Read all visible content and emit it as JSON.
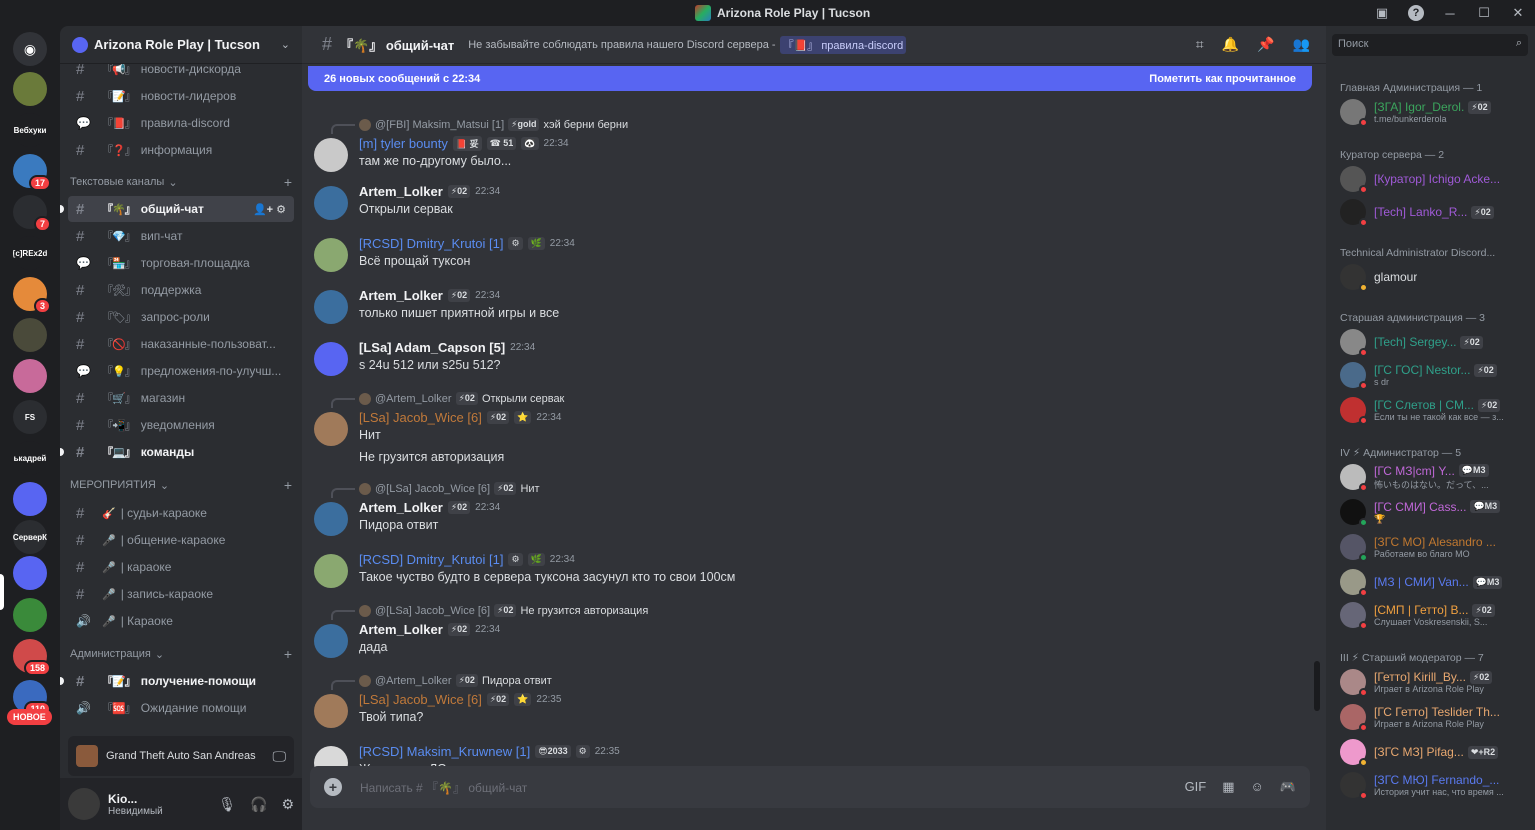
{
  "window": {
    "title": "Arizona Role Play | Tucson",
    "help_icon": "?"
  },
  "rail": {
    "discord_label": "Discord",
    "servers": [
      {
        "label": "",
        "color": "#6a7a3a",
        "badge": ""
      },
      {
        "label": "Вебхуки",
        "color": "#1e1f22",
        "badge": ""
      },
      {
        "label": "",
        "color": "#3a7abf",
        "badge": "17"
      },
      {
        "label": "",
        "color": "#2b2d31",
        "badge": "7"
      },
      {
        "label": "[c]REx2d",
        "color": "#1e1f22",
        "badge": ""
      },
      {
        "label": "",
        "color": "#e58a3a",
        "badge": "3"
      },
      {
        "label": "",
        "color": "#4a4a3a",
        "badge": ""
      },
      {
        "label": "",
        "color": "#c86a9a",
        "badge": ""
      },
      {
        "label": "FS",
        "color": "#2b2d31",
        "badge": ""
      },
      {
        "label": "ькадрей",
        "color": "#1e1f22",
        "badge": ""
      },
      {
        "label": "",
        "color": "#5865f2",
        "badge": ""
      },
      {
        "label": "СерверК",
        "color": "#2b2d31",
        "badge": ""
      },
      {
        "label": "",
        "color": "#5865f2",
        "badge": ""
      },
      {
        "label": "",
        "color": "#3a8a3a",
        "badge": ""
      },
      {
        "label": "",
        "color": "#d04a4a",
        "badge": "158"
      },
      {
        "label": "",
        "color": "#3a6abf",
        "badge": "110"
      }
    ],
    "new_label": "НОВОЕ"
  },
  "server": {
    "name": "Arizona Role Play | Tucson"
  },
  "channels": {
    "top": [
      {
        "emoji": "『📢』",
        "name": "новости-дискорда"
      },
      {
        "emoji": "『📝』",
        "name": "новости-лидеров"
      },
      {
        "emoji": "『📕』",
        "name": "правила-discord"
      },
      {
        "emoji": "『❓』",
        "name": "информация"
      }
    ],
    "cat_text": "Текстовые каналы",
    "text": [
      {
        "emoji": "『🌴』",
        "name": "общий-чат"
      },
      {
        "emoji": "『💎』",
        "name": "вип-чат"
      },
      {
        "emoji": "『🏪』",
        "name": "торговая-площадка"
      },
      {
        "emoji": "『🛠』",
        "name": "поддержка"
      },
      {
        "emoji": "『🏷』",
        "name": "запрос-роли"
      },
      {
        "emoji": "『🚫』",
        "name": "наказанные-пользоват..."
      },
      {
        "emoji": "『💡』",
        "name": "предложения-по-улучш..."
      },
      {
        "emoji": "『🛒』",
        "name": "магазин"
      },
      {
        "emoji": "『📲』",
        "name": "уведомления"
      },
      {
        "emoji": "『💻』",
        "name": "команды"
      }
    ],
    "cat_events": "МЕРОПРИЯТИЯ",
    "events": [
      {
        "emoji": "🎸",
        "name": "| судьи-караоке"
      },
      {
        "emoji": "🎤",
        "name": "| общение-караоке"
      },
      {
        "emoji": "🎤",
        "name": "| караоке"
      },
      {
        "emoji": "🎤",
        "name": "| запись-караоке"
      },
      {
        "emoji": "🎤",
        "name": "| Караоке"
      }
    ],
    "cat_admin": "Администрация",
    "admin": [
      {
        "emoji": "『📝』",
        "name": "получение-помощи"
      },
      {
        "emoji": "『🆘』",
        "name": "Ожидание помощи"
      }
    ]
  },
  "activity": {
    "game": "Grand Theft Auto San Andreas"
  },
  "user": {
    "name": "Kio...",
    "status": "Невидимый"
  },
  "chat": {
    "channel_name": "『🌴』 общий-чат",
    "topic": "Не забывайте соблюдать правила нашего Discord сервера -",
    "topic_link": "『📕』 правила-discord",
    "new_messages": "26 новых сообщений с 22:34",
    "mark_read": "Пометить как прочитанное",
    "composer_placeholder": "Написать # 『🌴』 общий-чат",
    "messages": [
      {
        "reply_user": "@[FBI] Maksim_Matsui [1]",
        "reply_tag": "⚡gold",
        "reply_text": "хэй берни берни",
        "user": "[m] tyler bounty",
        "user_class": "uname-blue",
        "tags": [
          "📕 妥",
          "☎ 51",
          "🐼"
        ],
        "time": "22:34",
        "lines": [
          "там же по-другому было..."
        ],
        "avatar": "#c9c9c9"
      },
      {
        "user": "Artem_Lolker",
        "user_class": "uname-m",
        "tags": [
          "⚡02"
        ],
        "time": "22:34",
        "lines": [
          "Открыли сервак"
        ],
        "avatar": "#3b6e9e"
      },
      {
        "user": "[RCSD] Dmitry_Krutoi [1]",
        "user_class": "uname-blue",
        "tags": [
          "⚙",
          "🌿"
        ],
        "time": "22:34",
        "lines": [
          "Всё прощай туксон"
        ],
        "avatar": "#8aa870"
      },
      {
        "user": "Artem_Lolker",
        "user_class": "uname-m",
        "tags": [
          "⚡02"
        ],
        "time": "22:34",
        "lines": [
          "только пишет приятной игры и все"
        ],
        "avatar": "#3b6e9e"
      },
      {
        "user": "[LSa] Adam_Capson [5]",
        "user_class": "uname-m",
        "tags": [],
        "time": "22:34",
        "lines": [
          "s 24u 512 или s25u 512?"
        ],
        "avatar": "#5865f2"
      },
      {
        "reply_user": "@Artem_Lolker",
        "reply_tag": "⚡02",
        "reply_text": "Открыли сервак",
        "user": "[LSa] Jacob_Wice [6]",
        "user_class": "uname-orange",
        "tags": [
          "⚡02",
          "⭐"
        ],
        "time": "22:34",
        "lines": [
          "Нит",
          "Не грузится авторизация"
        ],
        "avatar": "#a07a5a"
      },
      {
        "reply_user": "@[LSa] Jacob_Wice [6]",
        "reply_tag": "⚡02",
        "reply_text": "Нит",
        "user": "Artem_Lolker",
        "user_class": "uname-m",
        "tags": [
          "⚡02"
        ],
        "time": "22:34",
        "lines": [
          "Пидора отвит"
        ],
        "avatar": "#3b6e9e"
      },
      {
        "user": "[RCSD] Dmitry_Krutoi [1]",
        "user_class": "uname-blue",
        "tags": [
          "⚙",
          "🌿"
        ],
        "time": "22:34",
        "lines": [
          "Такое чуство будто в сервера туксона засунул кто то свои 100см"
        ],
        "avatar": "#8aa870"
      },
      {
        "reply_user": "@[LSa] Jacob_Wice [6]",
        "reply_tag": "⚡02",
        "reply_text": "Не грузится авторизация",
        "user": "Artem_Lolker",
        "user_class": "uname-m",
        "tags": [
          "⚡02"
        ],
        "time": "22:34",
        "lines": [
          "дада"
        ],
        "avatar": "#3b6e9e"
      },
      {
        "reply_user": "@Artem_Lolker",
        "reply_tag": "⚡02",
        "reply_text": "Пидора отвит",
        "user": "[LSa] Jacob_Wice [6]",
        "user_class": "uname-orange",
        "tags": [
          "⚡02",
          "⭐"
        ],
        "time": "22:35",
        "lines": [
          "Твой типа?"
        ],
        "avatar": "#a07a5a"
      },
      {
        "user": "[RCSD] Maksim_Kruwnew [1]",
        "user_class": "uname-blue",
        "tags": [
          "😎2033",
          "⚙"
        ],
        "time": "22:35",
        "lines": [
          "Женщина в ЛСа плохая примета"
        ],
        "avatar": "#d9d9d9"
      }
    ]
  },
  "members": {
    "search_placeholder": "Поиск",
    "groups": [
      {
        "title": "Главная Администрация — 1",
        "items": [
          {
            "name": "[ЗГА] Igor_Derol.",
            "color": "#3ba55d",
            "tag": "⚡02",
            "sub": "t.me/bunkerderola",
            "status": "#f23f42",
            "av": "#777"
          }
        ]
      },
      {
        "title": "Куратор сервера — 2",
        "items": [
          {
            "name": "[Куратор] Ichigo Acke...",
            "color": "#a05ad8",
            "tag": "",
            "sub": "",
            "status": "#f23f42",
            "av": "#555"
          },
          {
            "name": "[Tech] Lanko_R...",
            "color": "#a05ad8",
            "tag": "⚡02",
            "sub": "",
            "status": "#f23f42",
            "av": "#222"
          }
        ]
      },
      {
        "title": "Technical Administrator Discord...",
        "items": [
          {
            "name": "glamour",
            "color": "#dbdee1",
            "tag": "",
            "sub": "",
            "status": "#f0b232",
            "av": "#333"
          }
        ]
      },
      {
        "title": "Старшая администрация — 3",
        "items": [
          {
            "name": "[Tech] Sergey...",
            "color": "#2fa08a",
            "tag": "⚡02",
            "sub": "",
            "status": "#f23f42",
            "av": "#888"
          },
          {
            "name": "[ГС ГОС] Nestor...",
            "color": "#2fa08a",
            "tag": "⚡02",
            "sub": "s dr",
            "status": "#f23f42",
            "av": "#4a6a8a"
          },
          {
            "name": "[ГС Слетов | СМ...",
            "color": "#2fa08a",
            "tag": "⚡02",
            "sub": "Если ты не такой как все — з...",
            "status": "#f23f42",
            "av": "#c03030"
          }
        ]
      },
      {
        "title": "IV ⚡ Администратор — 5",
        "items": [
          {
            "name": "[ГС МЗ|cm] Y...",
            "color": "#c068d8",
            "tag": "💬M3",
            "sub": "怖いものはない。だって、...",
            "status": "#f23f42",
            "av": "#bbb"
          },
          {
            "name": "[ГС СМИ] Cass...",
            "color": "#c068d8",
            "tag": "💬M3",
            "sub": "🏆",
            "status": "#23a55a",
            "av": "#111"
          },
          {
            "name": "[ЗГС МО] Alesandro ...",
            "color": "#c07830",
            "tag": "",
            "sub": "Работаем во благо МО",
            "status": "#23a55a",
            "av": "#556"
          },
          {
            "name": "[МЗ | СМИ] Van...",
            "color": "#5a7af0",
            "tag": "💬M3",
            "sub": "",
            "status": "#f23f42",
            "av": "#998"
          },
          {
            "name": "[СМП | Гетто] В...",
            "color": "#f0a040",
            "tag": "⚡02",
            "sub": "Слушает Voskresenskii, S...",
            "status": "#f23f42",
            "av": "#667"
          }
        ]
      },
      {
        "title": "III ⚡ Старший модератор — 7",
        "items": [
          {
            "name": "[Гетто] Kirill_By...",
            "color": "#e8a870",
            "tag": "⚡02",
            "sub": "Играет в Arizona Role Play",
            "status": "#f23f42",
            "av": "#a88"
          },
          {
            "name": "[ГС Гетто] Teslider Th...",
            "color": "#e8a870",
            "tag": "",
            "sub": "Играет в Arizona Role Play",
            "status": "#f23f42",
            "av": "#a66"
          },
          {
            "name": "[ЗГС МЗ] Pifag...",
            "color": "#e8a870",
            "tag": "❤+R2",
            "sub": "",
            "status": "#f0b232",
            "av": "#e9c"
          },
          {
            "name": "[ЗГС МЮ] Fernando_...",
            "color": "#5a7af0",
            "tag": "",
            "sub": "История учит нас, что время ...",
            "status": "#f23f42",
            "av": "#333"
          }
        ]
      }
    ]
  }
}
